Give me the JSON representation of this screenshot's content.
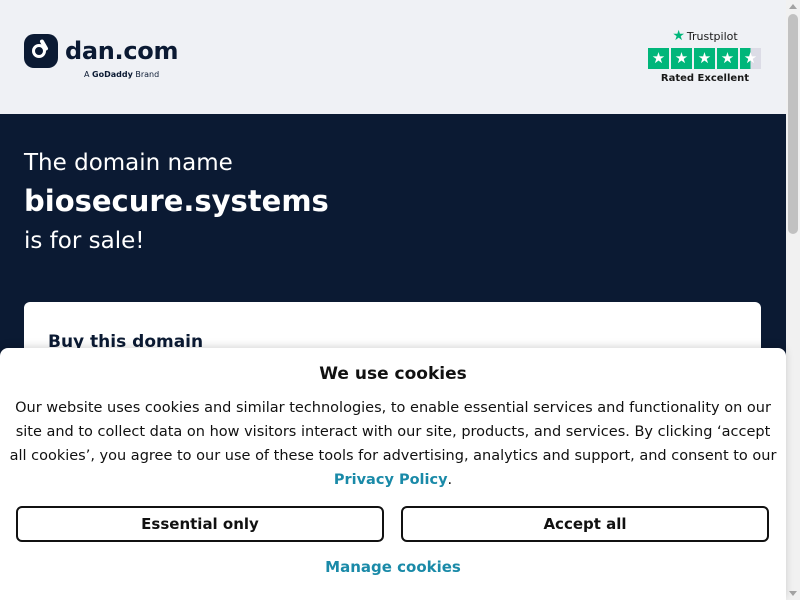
{
  "header": {
    "logo_text": "dan.com",
    "logo_sub_prefix": "A",
    "logo_sub_brand": "GoDaddy",
    "logo_sub_suffix": "Brand",
    "trustpilot": {
      "name": "Trustpilot",
      "rating_label": "Rated Excellent",
      "stars": 4.5,
      "brand_color": "#00b67a"
    }
  },
  "hero": {
    "line1": "The domain name",
    "domain": "biosecure.systems",
    "line3": "is for sale!"
  },
  "buy_card": {
    "title": "Buy this domain"
  },
  "cookie_banner": {
    "title": "We use cookies",
    "text": "Our website uses cookies and similar technologies, to enable essential services and functionality on our site and to collect data on how visitors interact with our site, products, and services. By clicking ‘accept all cookies’, you agree to our use of these tools for advertising, analytics and support, and consent to our",
    "privacy_link": "Privacy Policy",
    "text_end": ".",
    "essential_button": "Essential only",
    "accept_button": "Accept all",
    "manage_link": "Manage cookies",
    "link_color": "#1a8aa8"
  },
  "colors": {
    "navy": "#0b1a33",
    "header_bg": "#eff1f5"
  }
}
